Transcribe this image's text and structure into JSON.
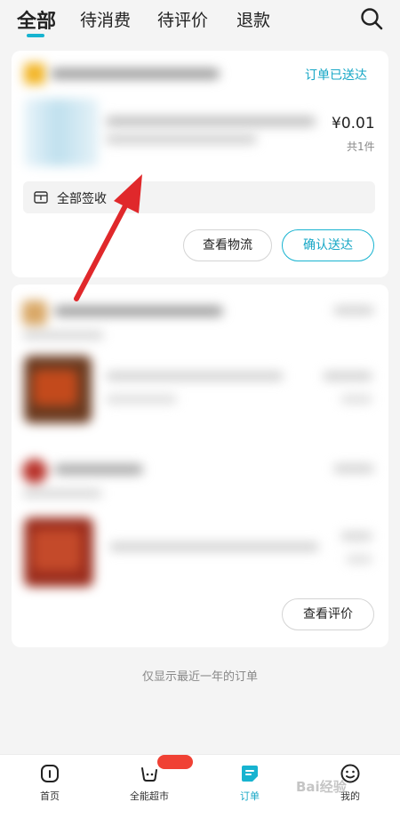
{
  "tabs": [
    {
      "label": "全部",
      "active": true
    },
    {
      "label": "待消费",
      "active": false
    },
    {
      "label": "待评价",
      "active": false
    },
    {
      "label": "退款",
      "active": false
    }
  ],
  "search_icon": "search-icon",
  "order1": {
    "status": "订单已送达",
    "price": "¥0.01",
    "count": "共1件",
    "sign_label": "全部签收",
    "buttons": {
      "logistics": "查看物流",
      "confirm": "确认送达"
    }
  },
  "order2": {
    "buttons": {
      "review": "查看评价"
    }
  },
  "footer_note": "仅显示最近一年的订单",
  "nav": [
    {
      "label": "首页",
      "icon": "home-icon",
      "active": false
    },
    {
      "label": "全能超市",
      "icon": "basket-icon",
      "active": false
    },
    {
      "label": "订单",
      "icon": "order-icon",
      "active": true
    },
    {
      "label": "我的",
      "icon": "profile-icon",
      "active": false
    }
  ],
  "watermark": "Bai经验",
  "colors": {
    "accent": "#17b3d0",
    "arrow": "#e0282b",
    "badge": "#f04134"
  }
}
